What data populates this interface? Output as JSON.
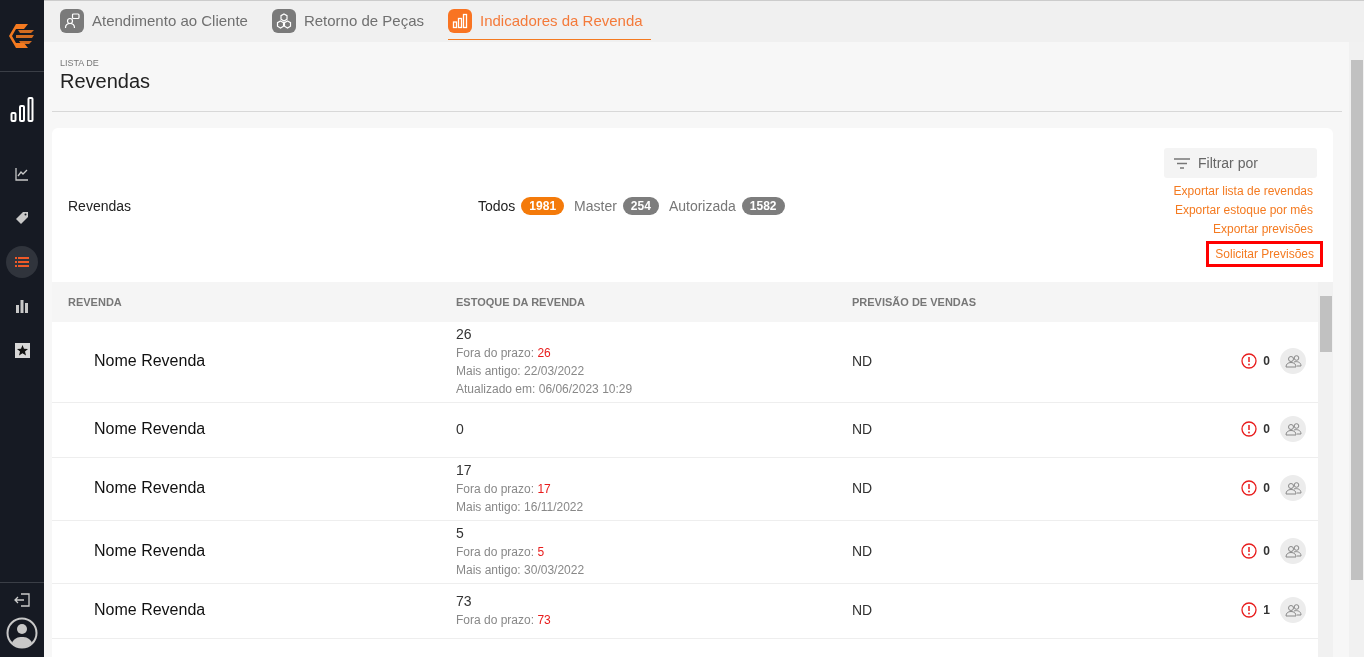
{
  "tabs": [
    {
      "label": "Atendimento ao Cliente",
      "selected": false
    },
    {
      "label": "Retorno de Peças",
      "selected": false
    },
    {
      "label": "Indicadores da Revenda",
      "selected": true
    }
  ],
  "sidebar": {
    "items": [
      {
        "selected": false
      },
      {
        "selected": false
      },
      {
        "selected": true
      },
      {
        "selected": false
      },
      {
        "selected": false
      }
    ]
  },
  "header": {
    "overline": "LISTA DE",
    "title": "Revendas"
  },
  "card": {
    "title": "Revendas",
    "filters": [
      {
        "label": "Todos",
        "count": "1981",
        "selected": true
      },
      {
        "label": "Master",
        "count": "254",
        "selected": false
      },
      {
        "label": "Autorizada",
        "count": "1582",
        "selected": false
      }
    ],
    "filter_field": {
      "placeholder": "Filtrar por"
    },
    "links": [
      {
        "label": "Exportar lista de revendas",
        "highlighted": false
      },
      {
        "label": "Exportar estoque por mês",
        "highlighted": false
      },
      {
        "label": "Exportar previsões",
        "highlighted": false
      },
      {
        "label": "Solicitar Previsões",
        "highlighted": true
      }
    ]
  },
  "table": {
    "columns": [
      "REVENDA",
      "ESTOQUE DA REVENDA",
      "PREVISÃO DE VENDAS"
    ],
    "rows": [
      {
        "name": "Nome Revenda",
        "stock": "26",
        "details": [
          {
            "label": "Fora do prazo:",
            "value": "26",
            "kind": "overdue"
          },
          {
            "label": "Mais antigo:",
            "value": "22/03/2022",
            "kind": "plain"
          },
          {
            "label": "Atualizado em:",
            "value": "06/06/2023 10:29",
            "kind": "plain"
          }
        ],
        "forecast": "ND",
        "alerts": "0"
      },
      {
        "name": "Nome Revenda",
        "stock": "0",
        "details": [],
        "forecast": "ND",
        "alerts": "0"
      },
      {
        "name": "Nome Revenda",
        "stock": "17",
        "details": [
          {
            "label": "Fora do prazo:",
            "value": "17",
            "kind": "overdue"
          },
          {
            "label": "Mais antigo:",
            "value": "16/11/2022",
            "kind": "plain"
          }
        ],
        "forecast": "ND",
        "alerts": "0"
      },
      {
        "name": "Nome Revenda",
        "stock": "5",
        "details": [
          {
            "label": "Fora do prazo:",
            "value": "5",
            "kind": "overdue"
          },
          {
            "label": "Mais antigo:",
            "value": "30/03/2022",
            "kind": "plain"
          }
        ],
        "forecast": "ND",
        "alerts": "0"
      },
      {
        "name": "Nome Revenda",
        "stock": "73",
        "details": [
          {
            "label": "Fora do prazo:",
            "value": "73",
            "kind": "overdue"
          }
        ],
        "forecast": "ND",
        "alerts": "1"
      }
    ]
  }
}
